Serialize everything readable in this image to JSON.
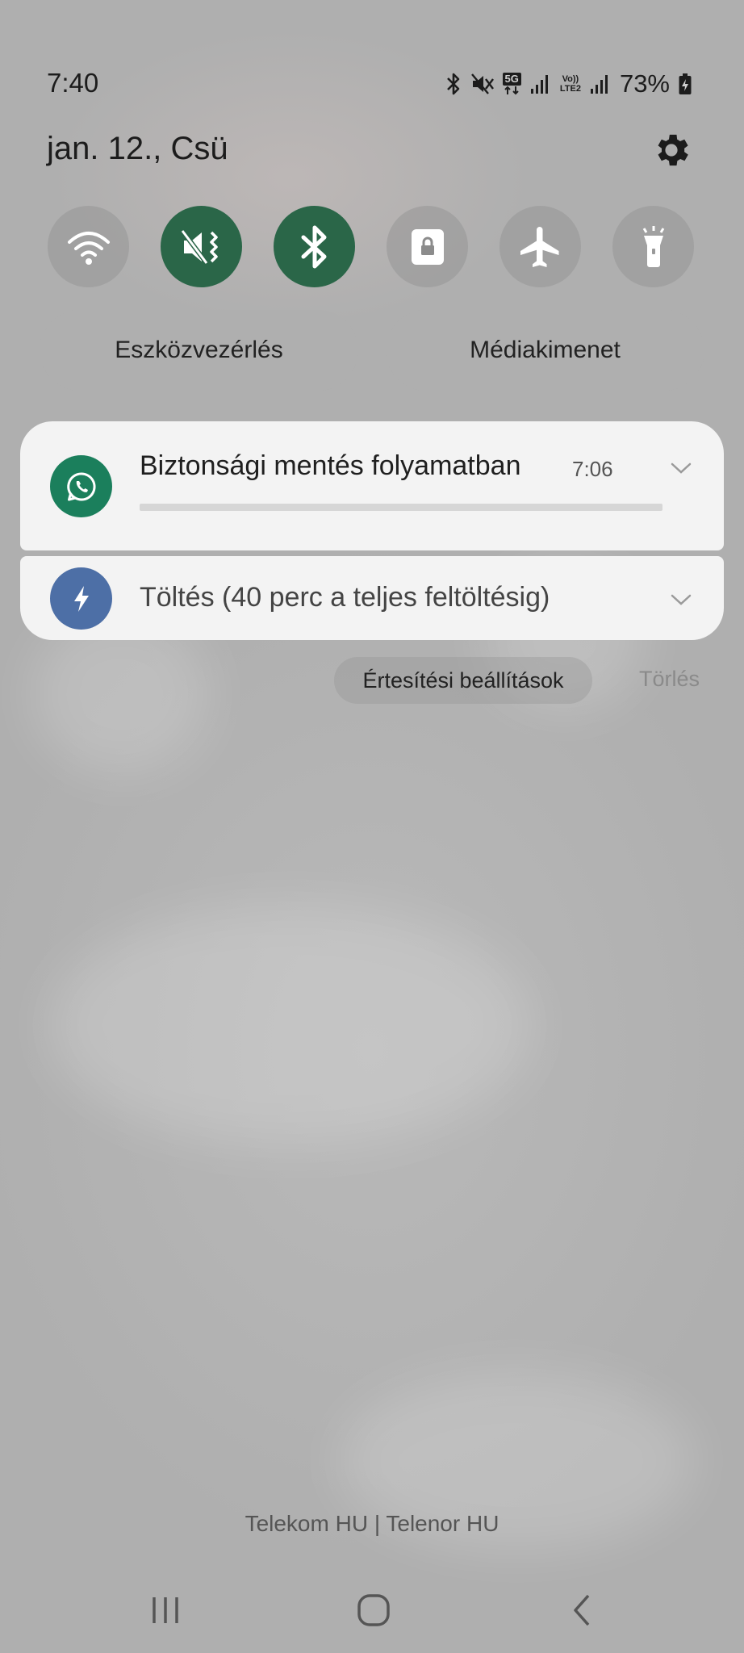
{
  "status_bar": {
    "time": "7:40",
    "network_5g": "5G",
    "volte_line1": "Vo))",
    "volte_line2": "LTE2",
    "battery_percent": "73%",
    "icons": [
      "bluetooth-icon",
      "mute-icon",
      "5g-icon",
      "signal-icon",
      "volte-icon",
      "signal-icon",
      "battery-charging-icon"
    ]
  },
  "header": {
    "date": "jan. 12., Csü",
    "settings_icon": "gear-icon"
  },
  "quick_toggles": [
    {
      "name": "wifi",
      "icon": "wifi-icon",
      "active": false
    },
    {
      "name": "sound",
      "icon": "mute-vibrate-icon",
      "active": true
    },
    {
      "name": "bluetooth",
      "icon": "bluetooth-icon",
      "active": true
    },
    {
      "name": "rotation-lock",
      "icon": "lock-icon",
      "active": false
    },
    {
      "name": "airplane",
      "icon": "airplane-icon",
      "active": false
    },
    {
      "name": "flashlight",
      "icon": "flashlight-icon",
      "active": false
    }
  ],
  "controls": {
    "device_control": "Eszközvezérlés",
    "media_output": "Médiakimenet"
  },
  "notifications": [
    {
      "app": "WhatsApp",
      "icon": "whatsapp-icon",
      "title": "Biztonsági mentés folyamatban",
      "time": "7:06",
      "progress": 0
    },
    {
      "app": "Charging",
      "icon": "charging-bolt-icon",
      "title": "Töltés (40 perc a teljes feltöltésig)"
    }
  ],
  "actions": {
    "notification_settings": "Értesítési beállítások",
    "clear": "Törlés"
  },
  "carrier": "Telekom HU | Telenor HU",
  "colors": {
    "toggle_active": "#2a6648",
    "whatsapp": "#1b7f5c",
    "charging": "#4d6fa6"
  }
}
